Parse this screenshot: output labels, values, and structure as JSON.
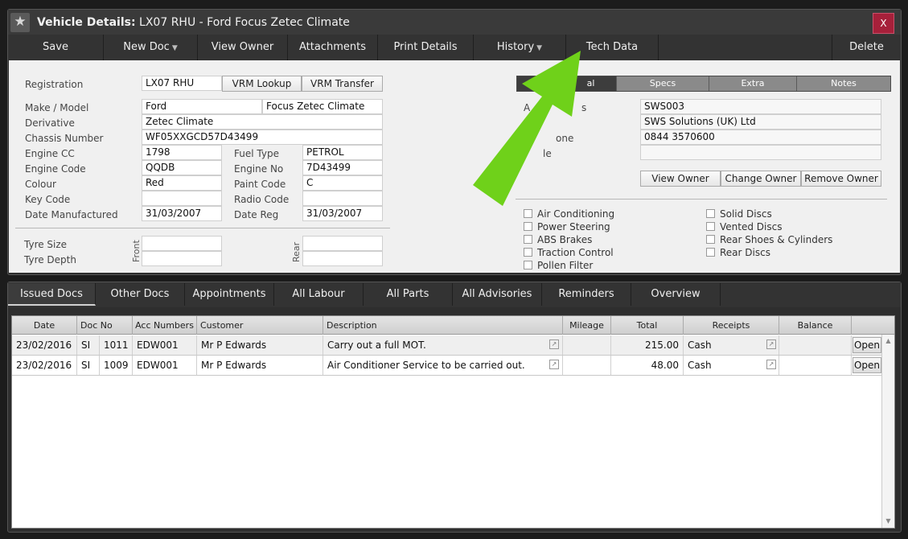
{
  "window": {
    "title_bold": "Vehicle Details:",
    "title_rest": " LX07 RHU - Ford Focus Zetec Climate",
    "close_label": "X"
  },
  "toolbar": {
    "save": "Save",
    "new_doc": "New Doc",
    "view_owner": "View Owner",
    "attachments": "Attachments",
    "print_details": "Print Details",
    "history": "History",
    "tech_data": "Tech Data",
    "delete": "Delete"
  },
  "vehicle": {
    "registration_label": "Registration",
    "registration": "LX07 RHU",
    "vrm_lookup": "VRM Lookup",
    "vrm_transfer": "VRM Transfer",
    "make_model_label": "Make / Model",
    "make": "Ford",
    "model": "Focus Zetec Climate",
    "derivative_label": "Derivative",
    "derivative": "Zetec Climate",
    "chassis_label": "Chassis Number",
    "chassis": "WF05XXGCD57D43499",
    "engine_cc_label": "Engine CC",
    "engine_cc": "1798",
    "fuel_type_label": "Fuel Type",
    "fuel_type": "PETROL",
    "engine_code_label": "Engine Code",
    "engine_code": "QQDB",
    "engine_no_label": "Engine No",
    "engine_no": "7D43499",
    "colour_label": "Colour",
    "colour": "Red",
    "paint_code_label": "Paint Code",
    "paint_code": "C",
    "key_code_label": "Key Code",
    "key_code": "",
    "radio_code_label": "Radio Code",
    "radio_code": "",
    "date_manufactured_label": "Date Manufactured",
    "date_manufactured": "31/03/2007",
    "date_reg_label": "Date Reg",
    "date_reg": "31/03/2007",
    "tyre_size_label": "Tyre Size",
    "tyre_depth_label": "Tyre Depth",
    "front_label": "Front",
    "rear_label": "Rear"
  },
  "side_tabs": {
    "general": "General",
    "general_visible": "al",
    "specs": "Specs",
    "extra": "Extra",
    "notes": "Notes"
  },
  "owner": {
    "account_label_fragment": "A",
    "account_label_tail": "s",
    "account": "SWS003",
    "name": "SWS Solutions (UK) Ltd",
    "phone_label_tail": "one",
    "phone": "0844 3570600",
    "mobile_label_tail": "le",
    "mobile": "",
    "view_owner": "View Owner",
    "change_owner": "Change Owner",
    "remove_owner": "Remove Owner"
  },
  "features_left": [
    "Air Conditioning",
    "Power Steering",
    "ABS Brakes",
    "Traction Control",
    "Pollen Filter"
  ],
  "features_right": [
    "Solid Discs",
    "Vented Discs",
    "Rear Shoes & Cylinders",
    "Rear Discs"
  ],
  "bottom_tabs": [
    "Issued Docs",
    "Other Docs",
    "Appointments",
    "All Labour",
    "All Parts",
    "All Advisories",
    "Reminders",
    "Overview"
  ],
  "grid": {
    "columns": [
      "Date",
      "Doc No",
      "Acc Numbers",
      "Customer",
      "Description",
      "Mileage",
      "Total",
      "Receipts",
      "Balance"
    ],
    "open_label": "Open",
    "rows": [
      {
        "date": "23/02/2016",
        "doc_type": "SI",
        "doc_no": "1011",
        "acc": "EDW001",
        "customer": "Mr P Edwards",
        "description": "Carry out a full MOT.",
        "mileage": "",
        "total": "215.00",
        "receipts": "Cash",
        "balance": ""
      },
      {
        "date": "23/02/2016",
        "doc_type": "SI",
        "doc_no": "1009",
        "acc": "EDW001",
        "customer": "Mr P Edwards",
        "description": "Air Conditioner Service to be carried out.",
        "mileage": "",
        "total": "48.00",
        "receipts": "Cash",
        "balance": ""
      }
    ]
  },
  "colors": {
    "annotation_arrow": "#6fd11a",
    "close_button": "#a6203a"
  }
}
